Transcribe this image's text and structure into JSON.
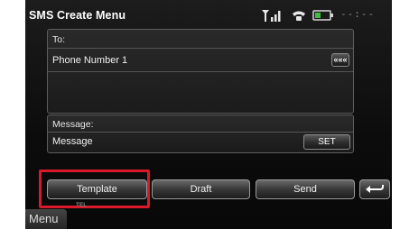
{
  "title_bar": {
    "title": "SMS Create Menu",
    "clock": "--:--"
  },
  "status_icons": [
    "signal-antenna-icon",
    "phone-handset-icon",
    "battery-icon"
  ],
  "to_panel": {
    "label": "To:",
    "value": "Phone Number 1",
    "back_button_label": "«««"
  },
  "message_panel": {
    "label": "Message:",
    "value": "Message",
    "set_button_label": "SET"
  },
  "bottom_buttons": {
    "template": "Template",
    "draft": "Draft",
    "send": "Send",
    "return_icon": "return-arrow-icon"
  },
  "highlight": {
    "target": "Template",
    "color": "#d7192a"
  },
  "footer": {
    "menu_label": "Menu",
    "tel_label": "TEL"
  },
  "colors": {
    "background": "#111111",
    "text": "#f2f2f2",
    "battery_level": "#3fbf3f",
    "highlight": "#d7192a"
  }
}
